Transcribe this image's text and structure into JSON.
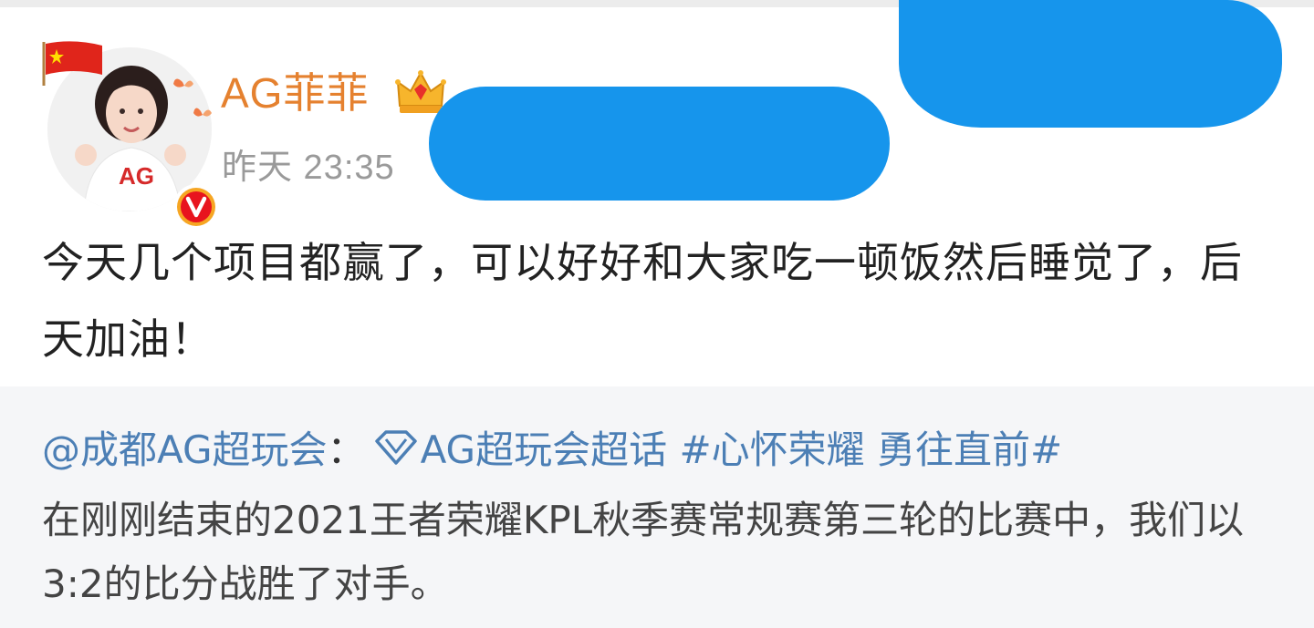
{
  "post": {
    "username": "AG菲菲",
    "timestamp": "昨天 23:35",
    "text": "今天几个项目都赢了，可以好好和大家吃一顿饭然后睡觉了，后天加油！"
  },
  "repost": {
    "author": "@成都AG超玩会",
    "separator": "：",
    "super_topic": "AG超玩会超话",
    "hashtag": "#心怀荣耀 勇往直前#",
    "text": "在刚刚结束的2021王者荣耀KPL秋季赛常规赛第三轮的比赛中，我们以3:2的比分战胜了对手。"
  },
  "icons": {
    "avatar": "avatar-photo",
    "flag": "china-flag-icon",
    "badge": "verified-v-icon",
    "crown": "crown-icon",
    "super_topic": "diamond-icon"
  },
  "colors": {
    "username": "#e5812f",
    "link": "#4c7fb5",
    "redaction": "#1695ec",
    "repost_bg": "#f5f6f8"
  }
}
